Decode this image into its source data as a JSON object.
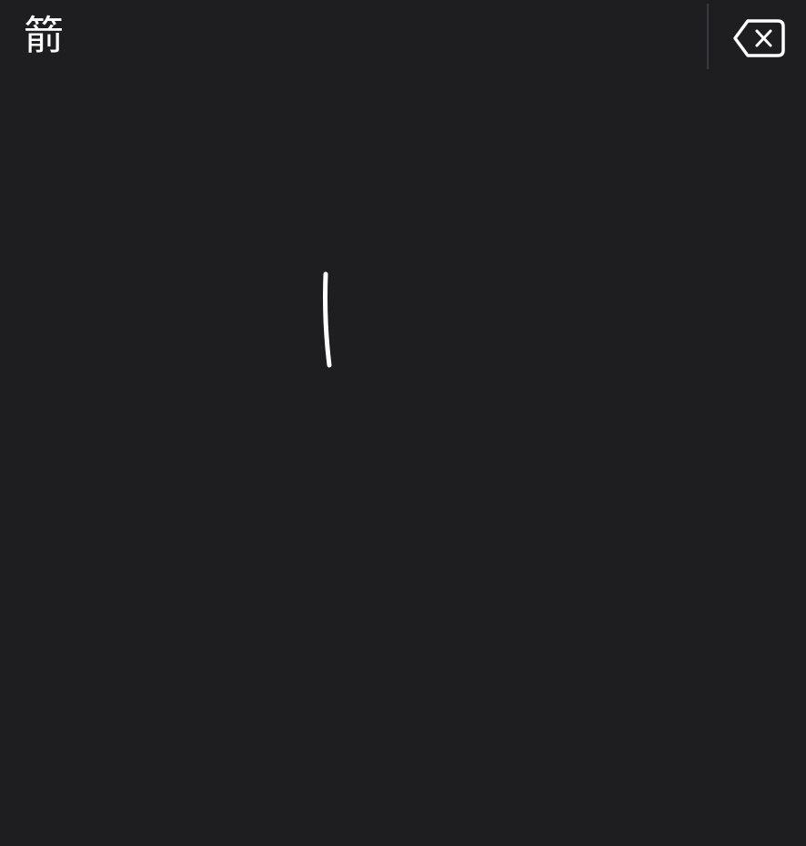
{
  "candidates": [
    {
      "text": "箭"
    }
  ],
  "delete_button": {
    "icon": "backspace-icon"
  },
  "colors": {
    "background": "#1e1d20",
    "foreground": "#ffffff",
    "divider": "#3a393d"
  }
}
